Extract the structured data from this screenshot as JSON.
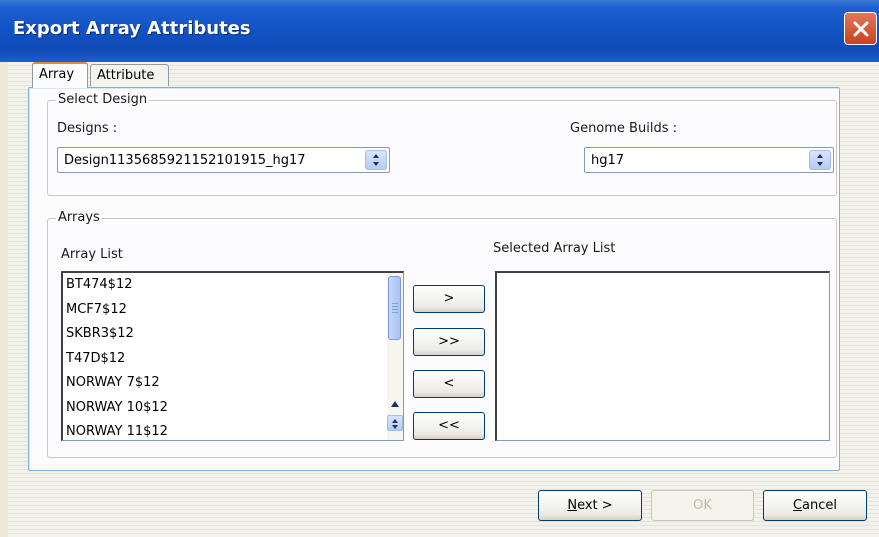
{
  "window": {
    "title": "Export Array Attributes"
  },
  "tabs": [
    {
      "label": "Array",
      "active": true
    },
    {
      "label": "Attribute",
      "active": false
    }
  ],
  "select_design": {
    "group_title": "Select Design",
    "designs_label": "Designs :",
    "designs_value": "Design1135685921152101915_hg17",
    "genome_label": "Genome Builds :",
    "genome_value": "hg17"
  },
  "arrays": {
    "group_title": "Arrays",
    "array_list_label": "Array List",
    "selected_list_label": "Selected Array List",
    "array_list": [
      "BT474$12",
      "MCF7$12",
      "SKBR3$12",
      "T47D$12",
      "NORWAY 7$12",
      "NORWAY 10$12",
      "NORWAY 11$12"
    ],
    "selected_list": []
  },
  "transfer_buttons": {
    "add": ">",
    "add_all": ">>",
    "remove": "<",
    "remove_all": "<<"
  },
  "footer": {
    "next_prefix": "N",
    "next_rest": "ext >",
    "ok": "OK",
    "cancel_prefix": "C",
    "cancel_rest": "ancel"
  },
  "icons": {
    "close": "close-icon",
    "combo_arrow": "up-down-arrow-icon",
    "scroll_up": "scroll-up-icon",
    "scroll_down": "scroll-down-icon"
  }
}
